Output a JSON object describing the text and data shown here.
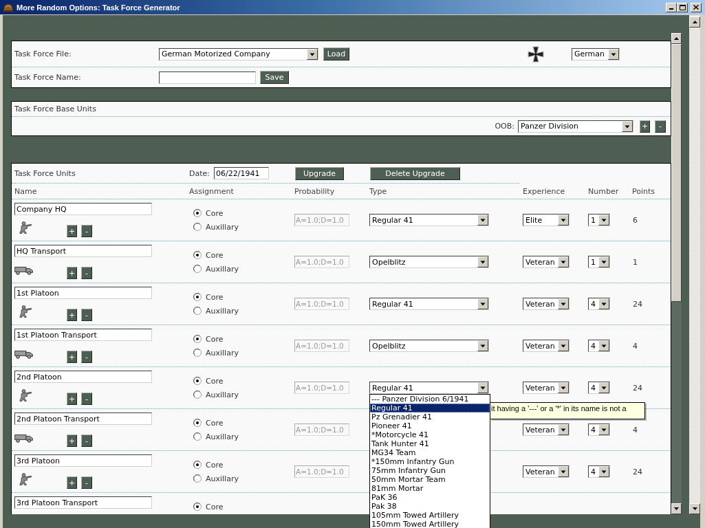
{
  "window": {
    "title": "More Random Options: Task Force Generator"
  },
  "file_panel": {
    "file_label": "Task Force File:",
    "file_value": "German Motorized Company",
    "load_button": "Load",
    "nation_value": "German",
    "name_label": "Task Force Name:",
    "save_button": "Save"
  },
  "base_units_panel": {
    "title": "Task Force Base Units",
    "oob_label": "OOB:",
    "oob_value": "Panzer Division",
    "buttons": [
      "+",
      "-"
    ]
  },
  "units_panel": {
    "title": "Task Force Units",
    "date_label": "Date:",
    "date_value": "06/22/1941",
    "buttons": [
      "Upgrade",
      "Delete Upgrade"
    ],
    "columns": [
      "Name",
      "Assignment",
      "Probability",
      "Type",
      "Experience",
      "Number",
      "Points"
    ],
    "rows": [
      {
        "name": "Company HQ",
        "kind": "infantry",
        "buttons": [
          "+",
          "-"
        ],
        "assignment": [
          {
            "label": "Core",
            "selected": true
          },
          {
            "label": "Auxillary",
            "selected": false
          }
        ],
        "probability": {
          "value": "A=1.0;D=1.0",
          "disabled": true
        },
        "type": "Regular 41",
        "experience": "Elite",
        "number": "1",
        "points": "6"
      },
      {
        "name": "HQ Transport",
        "kind": "truck",
        "buttons": [
          "+",
          "-"
        ],
        "assignment": [
          {
            "label": "Core",
            "selected": true
          },
          {
            "label": "Auxillary",
            "selected": false
          }
        ],
        "probability": {
          "value": "A=1.0;D=1.0",
          "disabled": true
        },
        "type": "Opelblitz",
        "experience": "Veteran",
        "number": "1",
        "points": "1"
      },
      {
        "name": "1st Platoon",
        "kind": "infantry",
        "buttons": [
          "+",
          "-"
        ],
        "assignment": [
          {
            "label": "Core",
            "selected": true
          },
          {
            "label": "Auxillary",
            "selected": false
          }
        ],
        "probability": {
          "value": "A=1.0;D=1.0",
          "disabled": true
        },
        "type": "Regular 41",
        "experience": "Veteran",
        "number": "4",
        "points": "24"
      },
      {
        "name": "1st Platoon Transport",
        "kind": "truck",
        "buttons": [
          "+",
          "-"
        ],
        "assignment": [
          {
            "label": "Core",
            "selected": true
          },
          {
            "label": "Auxillary",
            "selected": false
          }
        ],
        "probability": {
          "value": "A=1.0;D=1.0",
          "disabled": true
        },
        "type": "Opelblitz",
        "experience": "Veteran",
        "number": "4",
        "points": "4"
      },
      {
        "name": "2nd Platoon",
        "kind": "infantry",
        "buttons": [
          "+",
          "-"
        ],
        "assignment": [
          {
            "label": "Core",
            "selected": true
          },
          {
            "label": "Auxillary",
            "selected": false
          }
        ],
        "probability": {
          "value": "A=1.0;D=1.0",
          "disabled": true
        },
        "type": "Regular 41",
        "experience": "Veteran",
        "number": "4",
        "points": "24"
      },
      {
        "name": "2nd Platoon Transport",
        "kind": "truck",
        "buttons": [
          "+",
          "-"
        ],
        "assignment": [
          {
            "label": "Core",
            "selected": true
          },
          {
            "label": "Auxillary",
            "selected": false
          }
        ],
        "probability": {
          "value": "A=1.0;D=1.0",
          "disabled": true
        },
        "experience": "Veteran",
        "number": "4",
        "points": "4"
      },
      {
        "name": "3rd Platoon",
        "kind": "infantry",
        "buttons": [
          "+",
          "-"
        ],
        "assignment": [
          {
            "label": "Core",
            "selected": true
          },
          {
            "label": "Auxillary",
            "selected": false
          }
        ],
        "probability": {
          "value": "A=1.0;D=1.0",
          "disabled": true
        },
        "experience": "Veteran",
        "number": "4",
        "points": "24"
      },
      {
        "name": "3rd Platoon Transport",
        "assignment": [
          {
            "label": "Core",
            "selected": true
          }
        ]
      }
    ]
  },
  "type_dropdown_list": {
    "items": [
      {
        "label": "--- Panzer Division 6/1941",
        "selected": false
      },
      {
        "label": "Regular 41",
        "selected": true
      },
      {
        "label": "Pz Grenadier 41",
        "selected": false
      },
      {
        "label": "Pioneer 41",
        "selected": false
      },
      {
        "label": "*Motorcycle 41",
        "selected": false
      },
      {
        "label": "Tank Hunter 41",
        "selected": false
      },
      {
        "label": "MG34 Team",
        "selected": false
      },
      {
        "label": "*150mm Infantry Gun",
        "selected": false
      },
      {
        "label": "75mm Infantry Gun",
        "selected": false
      },
      {
        "label": "50mm Mortar Team",
        "selected": false
      },
      {
        "label": "81mm Mortar",
        "selected": false
      },
      {
        "label": "PaK 36",
        "selected": false
      },
      {
        "label": "Pak 38",
        "selected": false
      },
      {
        "label": "105mm Towed Artillery",
        "selected": false
      },
      {
        "label": "150mm Towed Artillery",
        "selected": false
      }
    ]
  },
  "tooltip": {
    "text": "it having a '---' or a '*' in its name is not a"
  }
}
